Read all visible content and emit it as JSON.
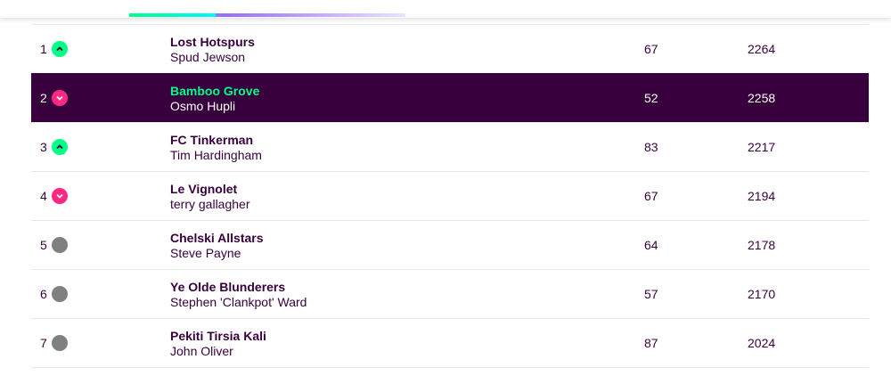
{
  "colors": {
    "brand_purple": "#37003c",
    "up": "#00ff87",
    "down": "#ff2882",
    "same": "#808080"
  },
  "standings": [
    {
      "rank": "1",
      "movement": "up",
      "movement_icon": "chevron-up-icon",
      "team": "Lost Hotspurs",
      "manager": "Spud Jewson",
      "gw": "67",
      "total": "2264"
    },
    {
      "rank": "2",
      "movement": "down",
      "movement_icon": "chevron-down-icon",
      "team": "Bamboo Grove",
      "manager": "Osmo Hupli",
      "gw": "52",
      "total": "2258",
      "selected": true
    },
    {
      "rank": "3",
      "movement": "up",
      "movement_icon": "chevron-up-icon",
      "team": "FC Tinkerman",
      "manager": "Tim Hardingham",
      "gw": "83",
      "total": "2217"
    },
    {
      "rank": "4",
      "movement": "down",
      "movement_icon": "chevron-down-icon",
      "team": "Le Vignolet",
      "manager": "terry gallagher",
      "gw": "67",
      "total": "2194"
    },
    {
      "rank": "5",
      "movement": "same",
      "movement_icon": "no-change-icon",
      "team": "Chelski Allstars",
      "manager": "Steve Payne",
      "gw": "64",
      "total": "2178"
    },
    {
      "rank": "6",
      "movement": "same",
      "movement_icon": "no-change-icon",
      "team": "Ye Olde Blunderers",
      "manager": "Stephen 'Clankpot' Ward",
      "gw": "57",
      "total": "2170"
    },
    {
      "rank": "7",
      "movement": "same",
      "movement_icon": "no-change-icon",
      "team": "Pekiti Tirsia Kali",
      "manager": "John Oliver",
      "gw": "87",
      "total": "2024"
    }
  ]
}
